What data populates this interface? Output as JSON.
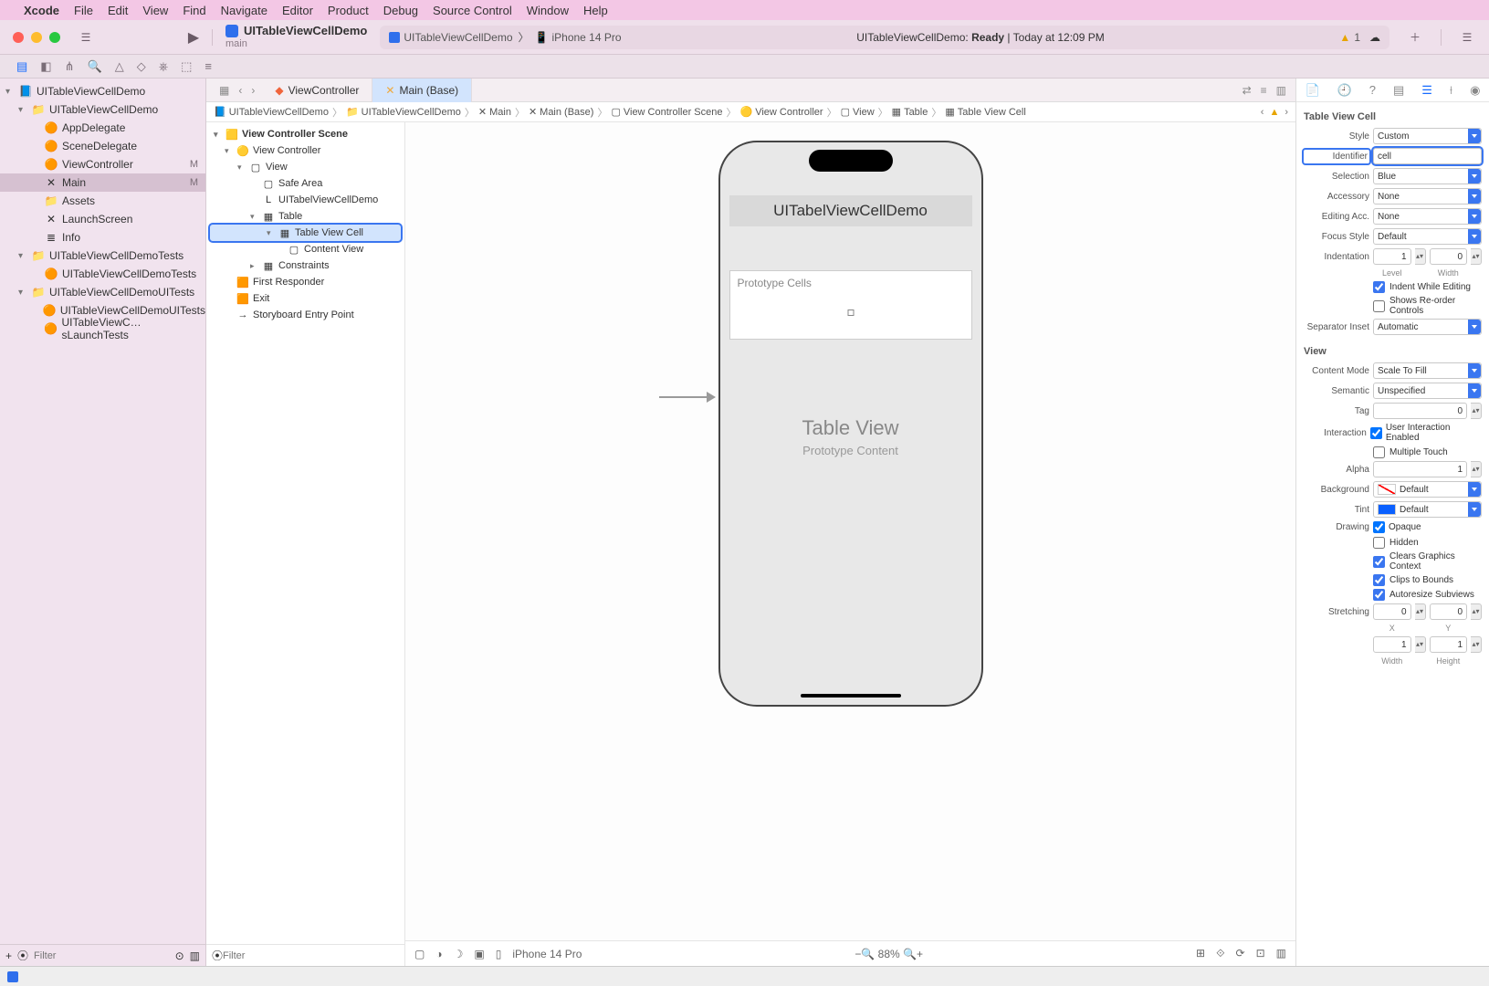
{
  "menubar": {
    "app": "Xcode",
    "items": [
      "File",
      "Edit",
      "View",
      "Find",
      "Navigate",
      "Editor",
      "Product",
      "Debug",
      "Source Control",
      "Window",
      "Help"
    ]
  },
  "toolbar": {
    "scheme_name": "UITableViewCellDemo",
    "scheme_branch": "main",
    "run_scheme": "UITableViewCellDemo",
    "run_dest": "iPhone 14 Pro",
    "status_prefix": "UITableViewCellDemo:",
    "status_state": "Ready",
    "status_time": "Today at 12:09 PM",
    "warn_count": "1"
  },
  "nav_tabs": {
    "tab1": "ViewController",
    "tab2": "Main (Base)"
  },
  "navigator": {
    "filter_placeholder": "Filter",
    "tree": [
      {
        "l": 0,
        "ico": "📘",
        "t": "UITableViewCellDemo",
        "chev": "▾"
      },
      {
        "l": 1,
        "ico": "📁",
        "t": "UITableViewCellDemo",
        "chev": "▾"
      },
      {
        "l": 2,
        "ico": "🟠",
        "t": "AppDelegate"
      },
      {
        "l": 2,
        "ico": "🟠",
        "t": "SceneDelegate"
      },
      {
        "l": 2,
        "ico": "🟠",
        "t": "ViewController",
        "mod": "M"
      },
      {
        "l": 2,
        "ico": "✕",
        "t": "Main",
        "mod": "M",
        "sel": true
      },
      {
        "l": 2,
        "ico": "📁",
        "t": "Assets"
      },
      {
        "l": 2,
        "ico": "✕",
        "t": "LaunchScreen"
      },
      {
        "l": 2,
        "ico": "≣",
        "t": "Info"
      },
      {
        "l": 1,
        "ico": "📁",
        "t": "UITableViewCellDemoTests",
        "chev": "▾"
      },
      {
        "l": 2,
        "ico": "🟠",
        "t": "UITableViewCellDemoTests"
      },
      {
        "l": 1,
        "ico": "📁",
        "t": "UITableViewCellDemoUITests",
        "chev": "▾"
      },
      {
        "l": 2,
        "ico": "🟠",
        "t": "UITableViewCellDemoUITests"
      },
      {
        "l": 2,
        "ico": "🟠",
        "t": "UITableViewC…sLaunchTests"
      }
    ]
  },
  "outline": {
    "filter_placeholder": "Filter",
    "root": "View Controller Scene",
    "items": [
      {
        "l": 0,
        "ico": "🟡",
        "t": "View Controller",
        "chev": "▾"
      },
      {
        "l": 1,
        "ico": "▢",
        "t": "View",
        "chev": "▾"
      },
      {
        "l": 2,
        "ico": "▢",
        "t": "Safe Area"
      },
      {
        "l": 2,
        "ico": "L",
        "t": "UITabelViewCellDemo"
      },
      {
        "l": 2,
        "ico": "▦",
        "t": "Table",
        "chev": "▾"
      },
      {
        "l": 3,
        "ico": "▦",
        "t": "Table View Cell",
        "chev": "▾",
        "sel": true
      },
      {
        "l": 4,
        "ico": "▢",
        "t": "Content View"
      },
      {
        "l": 2,
        "ico": "▦",
        "t": "Constraints",
        "chev": "▸"
      },
      {
        "l": 0,
        "ico": "🟧",
        "t": "First Responder",
        "noc": true
      },
      {
        "l": 0,
        "ico": "🟧",
        "t": "Exit",
        "noc": true
      },
      {
        "l": 0,
        "ico": "→",
        "t": "Storyboard Entry Point",
        "noc": true
      }
    ]
  },
  "jumpbar": [
    "UITableViewCellDemo",
    "UITableViewCellDemo",
    "Main",
    "Main (Base)",
    "View Controller Scene",
    "View Controller",
    "View",
    "Table",
    "Table View Cell"
  ],
  "canvas": {
    "title": "UITabelViewCellDemo",
    "proto": "Prototype Cells",
    "tv": "Table View",
    "tvsub": "Prototype Content",
    "device": "iPhone 14 Pro",
    "zoom": "88%"
  },
  "inspector": {
    "section": "Table View Cell",
    "style_l": "Style",
    "style": "Custom",
    "ident_l": "Identifier",
    "ident": "cell",
    "selection_l": "Selection",
    "selection": "Blue",
    "accessory_l": "Accessory",
    "accessory": "None",
    "editacc_l": "Editing Acc.",
    "editacc": "None",
    "focus_l": "Focus Style",
    "focus": "Default",
    "indent_l": "Indentation",
    "indent_level": "1",
    "indent_width": "0",
    "indent_level_l": "Level",
    "indent_width_l": "Width",
    "chk_indent": "Indent While Editing",
    "chk_reorder": "Shows Re-order Controls",
    "sepinset_l": "Separator Inset",
    "sepinset": "Automatic",
    "view_section": "View",
    "cmode_l": "Content Mode",
    "cmode": "Scale To Fill",
    "semantic_l": "Semantic",
    "semantic": "Unspecified",
    "tag_l": "Tag",
    "tag": "0",
    "inter_l": "Interaction",
    "chk_uie": "User Interaction Enabled",
    "chk_mt": "Multiple Touch",
    "alpha_l": "Alpha",
    "alpha": "1",
    "bg_l": "Background",
    "bg": "Default",
    "tint_l": "Tint",
    "tint": "Default",
    "draw_l": "Drawing",
    "chk_op": "Opaque",
    "chk_hid": "Hidden",
    "chk_cgc": "Clears Graphics Context",
    "chk_ctb": "Clips to Bounds",
    "chk_ars": "Autoresize Subviews",
    "stretch_l": "Stretching",
    "sx": "0",
    "sy": "0",
    "sw": "1",
    "sh": "1",
    "lx": "X",
    "ly": "Y",
    "lw": "Width",
    "lh": "Height"
  }
}
